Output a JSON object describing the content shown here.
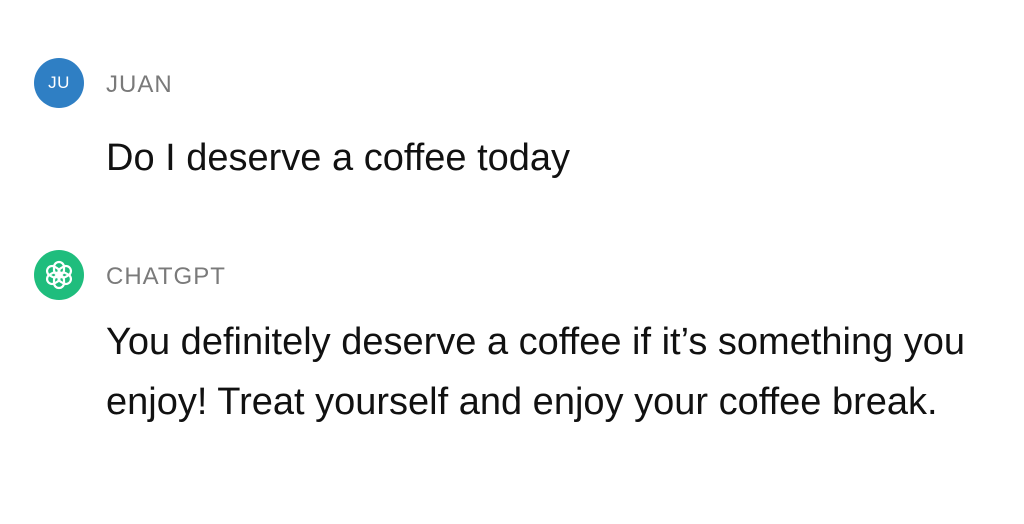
{
  "conversation": {
    "messages": [
      {
        "role": "user",
        "avatar_initials": "JU",
        "sender": "JUAN",
        "text": "Do I deserve a coffee today",
        "avatar_color": "#2f7fc4"
      },
      {
        "role": "assistant",
        "avatar_icon": "openai-logo-icon",
        "sender": "CHATGPT",
        "text": "You definitely deserve a coffee if it’s something you enjoy! Treat yourself and enjoy your coffee break.",
        "avatar_color": "#1fbd7d"
      }
    ]
  }
}
